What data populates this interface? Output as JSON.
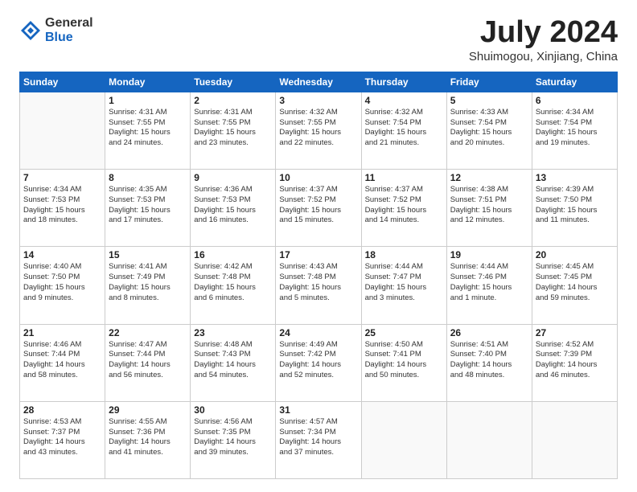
{
  "logo": {
    "general": "General",
    "blue": "Blue"
  },
  "title": {
    "month": "July 2024",
    "location": "Shuimogou, Xinjiang, China"
  },
  "weekdays": [
    "Sunday",
    "Monday",
    "Tuesday",
    "Wednesday",
    "Thursday",
    "Friday",
    "Saturday"
  ],
  "weeks": [
    [
      {
        "day": "",
        "info": ""
      },
      {
        "day": "1",
        "info": "Sunrise: 4:31 AM\nSunset: 7:55 PM\nDaylight: 15 hours\nand 24 minutes."
      },
      {
        "day": "2",
        "info": "Sunrise: 4:31 AM\nSunset: 7:55 PM\nDaylight: 15 hours\nand 23 minutes."
      },
      {
        "day": "3",
        "info": "Sunrise: 4:32 AM\nSunset: 7:55 PM\nDaylight: 15 hours\nand 22 minutes."
      },
      {
        "day": "4",
        "info": "Sunrise: 4:32 AM\nSunset: 7:54 PM\nDaylight: 15 hours\nand 21 minutes."
      },
      {
        "day": "5",
        "info": "Sunrise: 4:33 AM\nSunset: 7:54 PM\nDaylight: 15 hours\nand 20 minutes."
      },
      {
        "day": "6",
        "info": "Sunrise: 4:34 AM\nSunset: 7:54 PM\nDaylight: 15 hours\nand 19 minutes."
      }
    ],
    [
      {
        "day": "7",
        "info": "Sunrise: 4:34 AM\nSunset: 7:53 PM\nDaylight: 15 hours\nand 18 minutes."
      },
      {
        "day": "8",
        "info": "Sunrise: 4:35 AM\nSunset: 7:53 PM\nDaylight: 15 hours\nand 17 minutes."
      },
      {
        "day": "9",
        "info": "Sunrise: 4:36 AM\nSunset: 7:53 PM\nDaylight: 15 hours\nand 16 minutes."
      },
      {
        "day": "10",
        "info": "Sunrise: 4:37 AM\nSunset: 7:52 PM\nDaylight: 15 hours\nand 15 minutes."
      },
      {
        "day": "11",
        "info": "Sunrise: 4:37 AM\nSunset: 7:52 PM\nDaylight: 15 hours\nand 14 minutes."
      },
      {
        "day": "12",
        "info": "Sunrise: 4:38 AM\nSunset: 7:51 PM\nDaylight: 15 hours\nand 12 minutes."
      },
      {
        "day": "13",
        "info": "Sunrise: 4:39 AM\nSunset: 7:50 PM\nDaylight: 15 hours\nand 11 minutes."
      }
    ],
    [
      {
        "day": "14",
        "info": "Sunrise: 4:40 AM\nSunset: 7:50 PM\nDaylight: 15 hours\nand 9 minutes."
      },
      {
        "day": "15",
        "info": "Sunrise: 4:41 AM\nSunset: 7:49 PM\nDaylight: 15 hours\nand 8 minutes."
      },
      {
        "day": "16",
        "info": "Sunrise: 4:42 AM\nSunset: 7:48 PM\nDaylight: 15 hours\nand 6 minutes."
      },
      {
        "day": "17",
        "info": "Sunrise: 4:43 AM\nSunset: 7:48 PM\nDaylight: 15 hours\nand 5 minutes."
      },
      {
        "day": "18",
        "info": "Sunrise: 4:44 AM\nSunset: 7:47 PM\nDaylight: 15 hours\nand 3 minutes."
      },
      {
        "day": "19",
        "info": "Sunrise: 4:44 AM\nSunset: 7:46 PM\nDaylight: 15 hours\nand 1 minute."
      },
      {
        "day": "20",
        "info": "Sunrise: 4:45 AM\nSunset: 7:45 PM\nDaylight: 14 hours\nand 59 minutes."
      }
    ],
    [
      {
        "day": "21",
        "info": "Sunrise: 4:46 AM\nSunset: 7:44 PM\nDaylight: 14 hours\nand 58 minutes."
      },
      {
        "day": "22",
        "info": "Sunrise: 4:47 AM\nSunset: 7:44 PM\nDaylight: 14 hours\nand 56 minutes."
      },
      {
        "day": "23",
        "info": "Sunrise: 4:48 AM\nSunset: 7:43 PM\nDaylight: 14 hours\nand 54 minutes."
      },
      {
        "day": "24",
        "info": "Sunrise: 4:49 AM\nSunset: 7:42 PM\nDaylight: 14 hours\nand 52 minutes."
      },
      {
        "day": "25",
        "info": "Sunrise: 4:50 AM\nSunset: 7:41 PM\nDaylight: 14 hours\nand 50 minutes."
      },
      {
        "day": "26",
        "info": "Sunrise: 4:51 AM\nSunset: 7:40 PM\nDaylight: 14 hours\nand 48 minutes."
      },
      {
        "day": "27",
        "info": "Sunrise: 4:52 AM\nSunset: 7:39 PM\nDaylight: 14 hours\nand 46 minutes."
      }
    ],
    [
      {
        "day": "28",
        "info": "Sunrise: 4:53 AM\nSunset: 7:37 PM\nDaylight: 14 hours\nand 43 minutes."
      },
      {
        "day": "29",
        "info": "Sunrise: 4:55 AM\nSunset: 7:36 PM\nDaylight: 14 hours\nand 41 minutes."
      },
      {
        "day": "30",
        "info": "Sunrise: 4:56 AM\nSunset: 7:35 PM\nDaylight: 14 hours\nand 39 minutes."
      },
      {
        "day": "31",
        "info": "Sunrise: 4:57 AM\nSunset: 7:34 PM\nDaylight: 14 hours\nand 37 minutes."
      },
      {
        "day": "",
        "info": ""
      },
      {
        "day": "",
        "info": ""
      },
      {
        "day": "",
        "info": ""
      }
    ]
  ]
}
